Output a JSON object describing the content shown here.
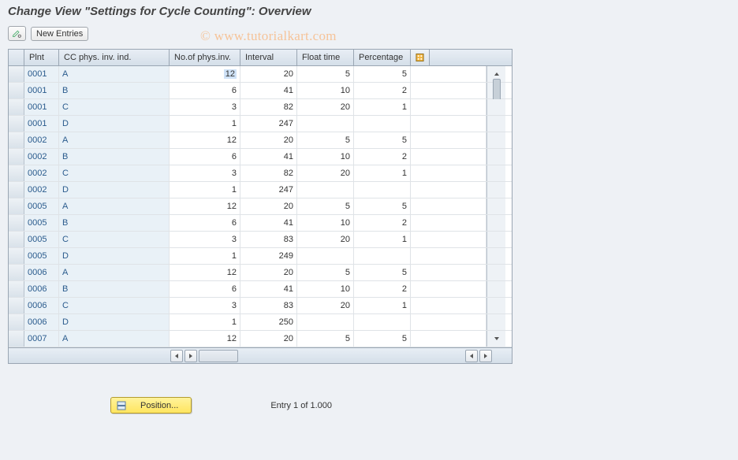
{
  "title": "Change View \"Settings for Cycle Counting\": Overview",
  "toolbar": {
    "new_entries": "New Entries"
  },
  "grid": {
    "headers": [
      "Plnt",
      "CC phys. inv. ind.",
      "No.of phys.inv.",
      "Interval",
      "Float time",
      "Percentage"
    ],
    "rows": [
      {
        "plant": "0001",
        "cc": "A",
        "num": "12",
        "int": "20",
        "float": "5",
        "pct": "5"
      },
      {
        "plant": "0001",
        "cc": "B",
        "num": "6",
        "int": "41",
        "float": "10",
        "pct": "2"
      },
      {
        "plant": "0001",
        "cc": "C",
        "num": "3",
        "int": "82",
        "float": "20",
        "pct": "1"
      },
      {
        "plant": "0001",
        "cc": "D",
        "num": "1",
        "int": "247",
        "float": "",
        "pct": ""
      },
      {
        "plant": "0002",
        "cc": "A",
        "num": "12",
        "int": "20",
        "float": "5",
        "pct": "5"
      },
      {
        "plant": "0002",
        "cc": "B",
        "num": "6",
        "int": "41",
        "float": "10",
        "pct": "2"
      },
      {
        "plant": "0002",
        "cc": "C",
        "num": "3",
        "int": "82",
        "float": "20",
        "pct": "1"
      },
      {
        "plant": "0002",
        "cc": "D",
        "num": "1",
        "int": "247",
        "float": "",
        "pct": ""
      },
      {
        "plant": "0005",
        "cc": "A",
        "num": "12",
        "int": "20",
        "float": "5",
        "pct": "5"
      },
      {
        "plant": "0005",
        "cc": "B",
        "num": "6",
        "int": "41",
        "float": "10",
        "pct": "2"
      },
      {
        "plant": "0005",
        "cc": "C",
        "num": "3",
        "int": "83",
        "float": "20",
        "pct": "1"
      },
      {
        "plant": "0005",
        "cc": "D",
        "num": "1",
        "int": "249",
        "float": "",
        "pct": ""
      },
      {
        "plant": "0006",
        "cc": "A",
        "num": "12",
        "int": "20",
        "float": "5",
        "pct": "5"
      },
      {
        "plant": "0006",
        "cc": "B",
        "num": "6",
        "int": "41",
        "float": "10",
        "pct": "2"
      },
      {
        "plant": "0006",
        "cc": "C",
        "num": "3",
        "int": "83",
        "float": "20",
        "pct": "1"
      },
      {
        "plant": "0006",
        "cc": "D",
        "num": "1",
        "int": "250",
        "float": "",
        "pct": ""
      },
      {
        "plant": "0007",
        "cc": "A",
        "num": "12",
        "int": "20",
        "float": "5",
        "pct": "5"
      }
    ]
  },
  "footer": {
    "position": "Position...",
    "entry_text": "Entry 1 of 1.000"
  },
  "watermark": "© www.tutorialkart.com"
}
